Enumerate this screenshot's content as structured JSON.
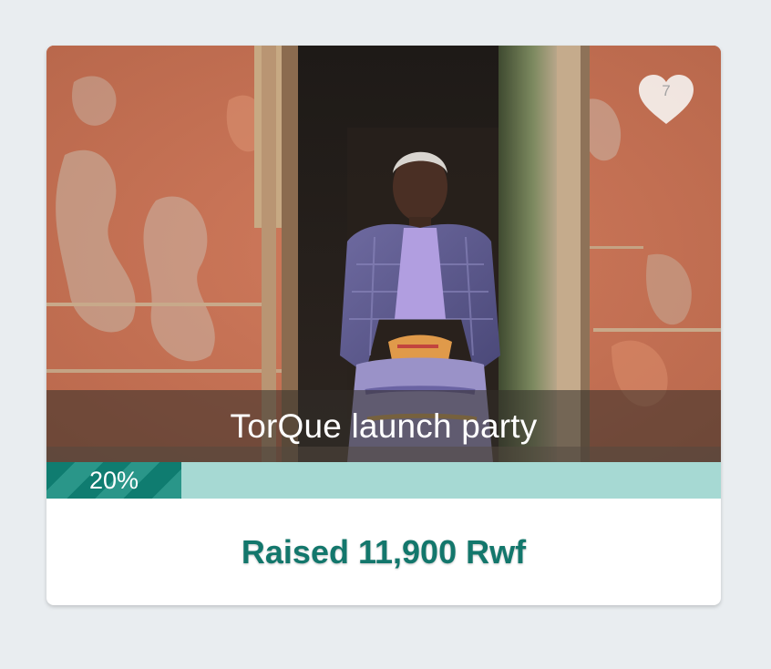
{
  "campaign": {
    "title": "TorQue launch party",
    "favorite_count": "7",
    "progress_label": "20%",
    "progress_fraction": 0.2,
    "raised_text": "Raised 11,900 Rwf"
  },
  "colors": {
    "page_background": "#e9edf0",
    "accent": "#13776c",
    "progress_fill": "#0f7c70",
    "progress_track": "#a6d9d3"
  },
  "icons": {
    "favorite": "heart-icon"
  }
}
